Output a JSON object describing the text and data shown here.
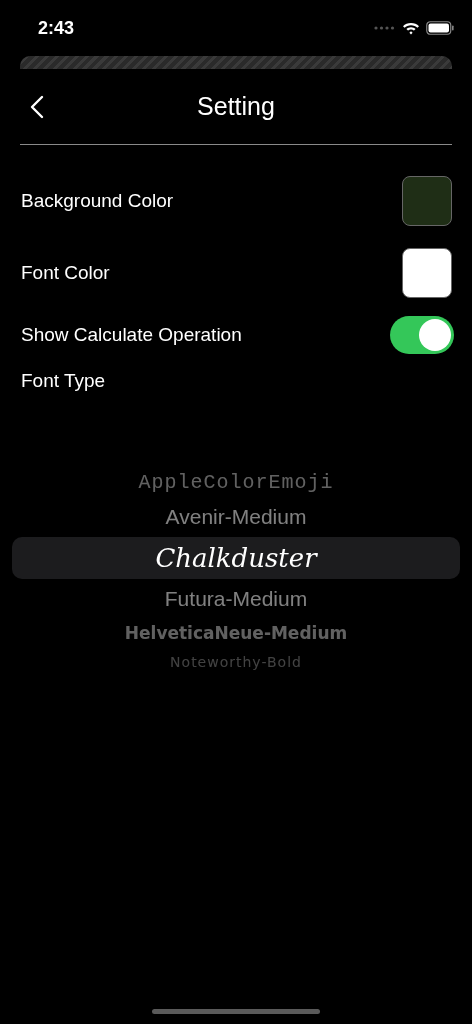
{
  "status_bar": {
    "time": "2:43"
  },
  "nav": {
    "title": "Setting"
  },
  "settings": [
    {
      "kind": "swatch",
      "label": "Background Color",
      "color": "#1f2e16"
    },
    {
      "kind": "swatch",
      "label": "Font Color",
      "color": "#ffffff"
    },
    {
      "kind": "toggle",
      "label": "Show Calculate Operation",
      "on": true
    },
    {
      "kind": "heading",
      "label": "Font Type"
    }
  ],
  "font_picker": [
    {
      "label": "AppleColorEmoji",
      "kind": "mono",
      "selected": false
    },
    {
      "label": "Avenir-Medium",
      "kind": "sans",
      "selected": false
    },
    {
      "label": "Chalkduster",
      "kind": "hand",
      "selected": true
    },
    {
      "label": "Futura-Medium",
      "kind": "sans",
      "selected": false
    },
    {
      "label": "HelveticaNeue-Medium",
      "kind": "bold",
      "selected": false
    },
    {
      "label": "Noteworthy-Bold",
      "kind": "small",
      "selected": false
    }
  ]
}
